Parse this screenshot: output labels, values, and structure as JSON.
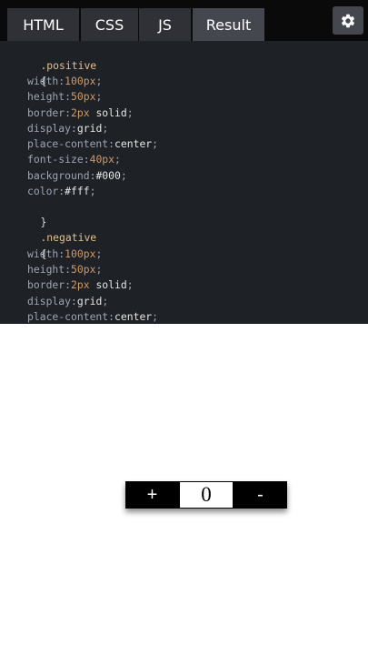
{
  "tabs": [
    {
      "label": "HTML"
    },
    {
      "label": "CSS"
    },
    {
      "label": "JS"
    },
    {
      "label": "Result"
    }
  ],
  "active_tab": "Result",
  "settings_icon": "gear-icon",
  "code": {
    "line1": {
      "selector": ".positive"
    },
    "line2": {
      "brace": "{"
    },
    "line3": {
      "prop": "width",
      "colon": ":",
      "num": "100px",
      "semi": ";"
    },
    "line4": {
      "prop": "height",
      "colon": ":",
      "num": "50px",
      "semi": ";"
    },
    "line5": {
      "prop": "border",
      "colon": ":",
      "num": "2px",
      "val": " solid",
      "semi": ";"
    },
    "line6": {
      "prop": "display",
      "colon": ":",
      "val": "grid",
      "semi": ";"
    },
    "line7": {
      "prop": "place-content",
      "colon": ":",
      "val": "center",
      "semi": ";"
    },
    "line8": {
      "prop": "font-size",
      "colon": ":",
      "num": "40px",
      "semi": ";"
    },
    "line9": {
      "prop": "background",
      "colon": ":",
      "val": "#000",
      "semi": ";"
    },
    "line10": {
      "prop": "color",
      "colon": ":",
      "val": "#fff",
      "semi": ";"
    },
    "line11": {
      "brace": "}"
    },
    "line12": {
      "selector": ".negative"
    },
    "line13": {
      "brace": "{"
    },
    "line14": {
      "prop": "width",
      "colon": ":",
      "num": "100px",
      "semi": ";"
    },
    "line15": {
      "prop": "height",
      "colon": ":",
      "num": "50px",
      "semi": ";"
    },
    "line16": {
      "prop": "border",
      "colon": ":",
      "num": "2px",
      "val": " solid",
      "semi": ";"
    },
    "line17": {
      "prop": "display",
      "colon": ":",
      "val": "grid",
      "semi": ";"
    },
    "line18": {
      "prop": "place-content",
      "colon": ":",
      "val": "center",
      "semi": ";"
    }
  },
  "counter": {
    "plus_label": "+",
    "value": "0",
    "minus_label": "-"
  }
}
